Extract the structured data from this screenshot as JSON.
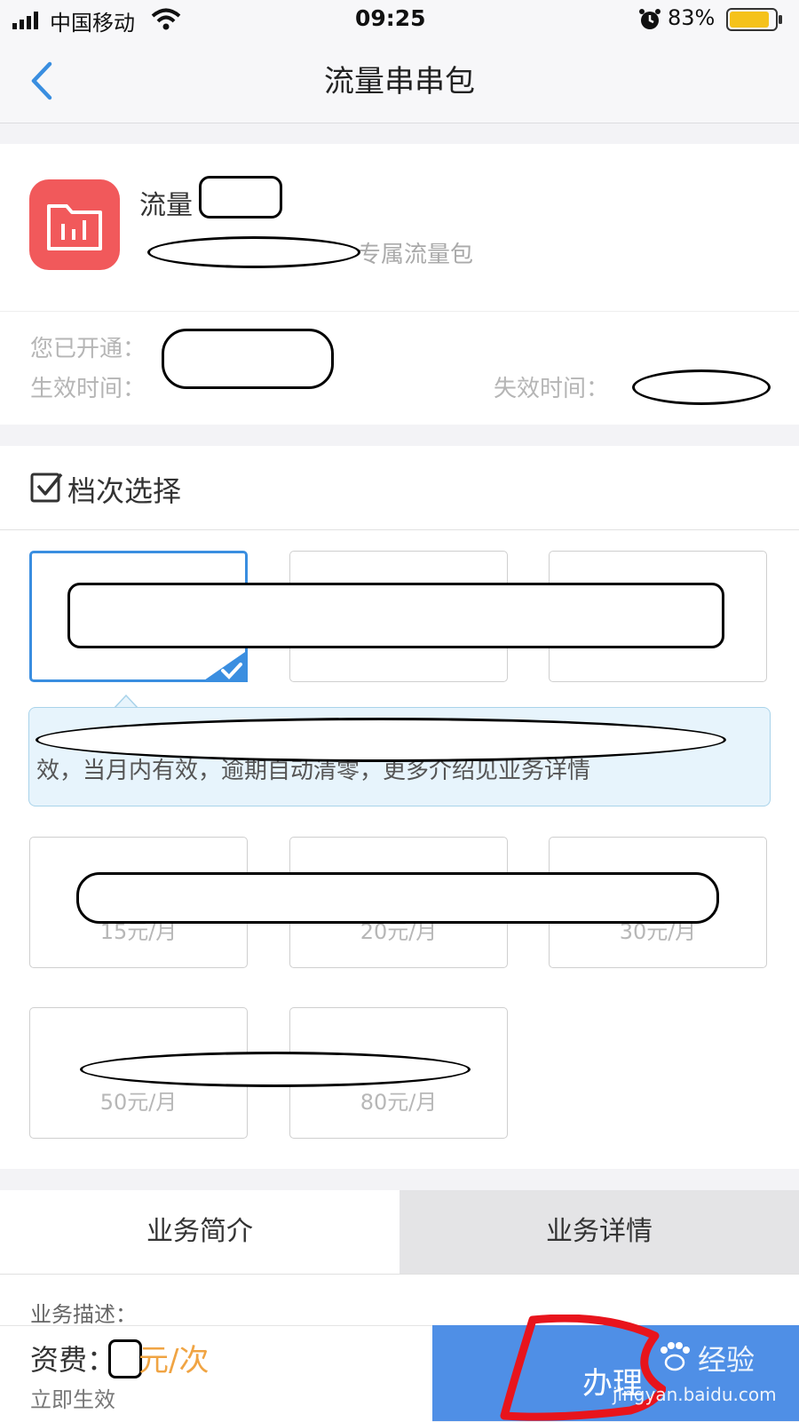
{
  "status_bar": {
    "carrier": "中国移动",
    "time": "09:25",
    "battery_percent": "83%"
  },
  "nav": {
    "title": "流量串串包"
  },
  "product": {
    "name": "流量",
    "subtitle_suffix": "专属流量包",
    "opened_label": "您已开通：",
    "effective_label": "生效时间：",
    "expire_label": "失效时间："
  },
  "tiers": {
    "header": "档次选择",
    "row2_prices": [
      "15元/月",
      "20元/月",
      "30元/月"
    ],
    "row3_prices": [
      "50元/月",
      "80元/月"
    ],
    "tip_text": "效，当月内有效，逾期自动清零，更多介绍见业务详情"
  },
  "tabs": {
    "intro": "业务简介",
    "details": "业务详情"
  },
  "description": {
    "label": "业务描述："
  },
  "bottom": {
    "fee_label": "资费：",
    "fee_unit": "元/次",
    "instant": "立即生效",
    "apply": "办理"
  },
  "watermark": {
    "brand": "经验",
    "url": "jingyan.baidu.com"
  },
  "colors": {
    "accent_blue": "#3a8ee0",
    "button_blue": "#4f8fe6",
    "price_orange": "#f0a443",
    "icon_red": "#f1595b"
  }
}
